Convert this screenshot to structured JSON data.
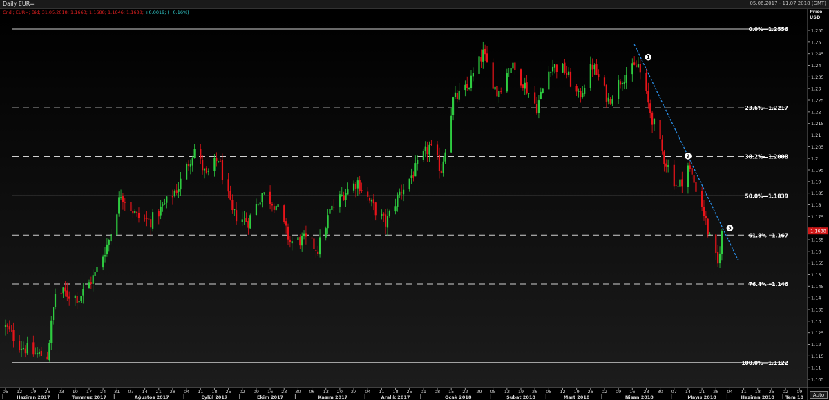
{
  "window": {
    "title": "Daily EUR=",
    "date_range": "05.06.2017 - 11.07.2018 (GMT)"
  },
  "ohlc_line": {
    "text": "Cndl; EUR=; Bid; 31.05.2018; 1.1663; 1.1688; 1.1646; 1.1688;",
    "change": "+0.0019; (+0.16%)"
  },
  "price_axis": {
    "title_line1": "Price",
    "title_line2": "USD",
    "current_price": "1.1688",
    "ticks": [
      "1.255",
      "1.25",
      "1.245",
      "1.24",
      "1.235",
      "1.23",
      "1.225",
      "1.22",
      "1.215",
      "1.21",
      "1.205",
      "1.2",
      "1.195",
      "1.19",
      "1.185",
      "1.18",
      "1.175",
      "1.17",
      "1.165",
      "1.16",
      "1.155",
      "1.15",
      "1.145",
      "1.14",
      "1.135",
      "1.13",
      "1.125",
      "1.12",
      "1.115",
      "1.11",
      "1.105"
    ]
  },
  "colors": {
    "background": "#000000",
    "up_candle": "#2ecc40",
    "down_candle": "#e8141a",
    "fib_line": "#d0d0d0",
    "trendline": "#2a8fe8",
    "price_tag": "#d01818"
  },
  "auto_button": {
    "label": "Auto"
  },
  "chart_data": {
    "type": "candlestick",
    "symbol": "EUR=",
    "ylim": [
      1.1025,
      1.2605
    ],
    "date_range": [
      "2017-06-05",
      "2018-07-11"
    ],
    "x_tick_labels": [
      "05",
      "12",
      "19",
      "26",
      "03",
      "10",
      "17",
      "24",
      "31",
      "07",
      "14",
      "21",
      "28",
      "04",
      "11",
      "18",
      "25",
      "02",
      "09",
      "16",
      "23",
      "30",
      "06",
      "13",
      "20",
      "27",
      "04",
      "11",
      "18",
      "25",
      "01",
      "08",
      "15",
      "22",
      "29",
      "05",
      "12",
      "19",
      "26",
      "05",
      "12",
      "19",
      "26",
      "02",
      "09",
      "16",
      "23",
      "30",
      "07",
      "14",
      "21",
      "28",
      "04",
      "11",
      "18",
      "25",
      "02",
      "09"
    ],
    "month_labels": [
      {
        "label": "Haziran 2017",
        "tick_index": 0
      },
      {
        "label": "Temmuz 2017",
        "tick_index": 4
      },
      {
        "label": "Ağustos 2017",
        "tick_index": 8
      },
      {
        "label": "Eylül 2017",
        "tick_index": 13
      },
      {
        "label": "Ekim 2017",
        "tick_index": 17
      },
      {
        "label": "Kasım 2017",
        "tick_index": 21
      },
      {
        "label": "Aralık 2017",
        "tick_index": 26
      },
      {
        "label": "Ocak 2018",
        "tick_index": 30
      },
      {
        "label": "Şubat 2018",
        "tick_index": 35
      },
      {
        "label": "Mart 2018",
        "tick_index": 39
      },
      {
        "label": "Nisan 2018",
        "tick_index": 43
      },
      {
        "label": "Mayıs 2018",
        "tick_index": 48
      },
      {
        "label": "Haziran 2018",
        "tick_index": 52
      },
      {
        "label": "Tem 18",
        "tick_index": 56
      }
    ],
    "fib_levels": [
      {
        "label": "0.0%—1.2556",
        "value": 1.2556,
        "style": "solid"
      },
      {
        "label": "23.6%—1.2217",
        "value": 1.2217,
        "style": "dashed"
      },
      {
        "label": "38.2%—1.2008",
        "value": 1.2008,
        "style": "dashed"
      },
      {
        "label": "50.0%—1.1839",
        "value": 1.1839,
        "style": "solid"
      },
      {
        "label": "61.8%—1.167",
        "value": 1.167,
        "style": "dashed"
      },
      {
        "label": "76.4%—1.146",
        "value": 1.146,
        "style": "dashed"
      },
      {
        "label": "100.0%—1.1122",
        "value": 1.1122,
        "style": "solid"
      }
    ],
    "trendline": {
      "start": {
        "date": "2018-04-17",
        "price": 1.249
      },
      "end": {
        "date": "2018-06-08",
        "price": 1.1565
      }
    },
    "markers": [
      {
        "label": "1",
        "date": "2018-04-24",
        "price": 1.2435
      },
      {
        "label": "2",
        "date": "2018-05-14",
        "price": 1.201
      },
      {
        "label": "3",
        "date": "2018-06-04",
        "price": 1.17
      }
    ],
    "last_close": 1.1688,
    "anchor_closes": [
      [
        "2017-06-05",
        1.1275
      ],
      [
        "2017-06-12",
        1.12
      ],
      [
        "2017-06-19",
        1.116
      ],
      [
        "2017-06-26",
        1.115
      ],
      [
        "2017-06-30",
        1.142
      ],
      [
        "2017-07-05",
        1.142
      ],
      [
        "2017-07-12",
        1.14
      ],
      [
        "2017-07-20",
        1.15
      ],
      [
        "2017-07-27",
        1.165
      ],
      [
        "2017-08-02",
        1.185
      ],
      [
        "2017-08-10",
        1.175
      ],
      [
        "2017-08-17",
        1.173
      ],
      [
        "2017-08-24",
        1.18
      ],
      [
        "2017-08-31",
        1.188
      ],
      [
        "2017-09-08",
        1.204
      ],
      [
        "2017-09-14",
        1.192
      ],
      [
        "2017-09-20",
        1.2
      ],
      [
        "2017-09-27",
        1.176
      ],
      [
        "2017-10-05",
        1.173
      ],
      [
        "2017-10-12",
        1.185
      ],
      [
        "2017-10-19",
        1.18
      ],
      [
        "2017-10-26",
        1.164
      ],
      [
        "2017-11-02",
        1.165
      ],
      [
        "2017-11-09",
        1.161
      ],
      [
        "2017-11-15",
        1.177
      ],
      [
        "2017-11-22",
        1.185
      ],
      [
        "2017-11-29",
        1.19
      ],
      [
        "2017-12-06",
        1.18
      ],
      [
        "2017-12-13",
        1.172
      ],
      [
        "2017-12-20",
        1.185
      ],
      [
        "2017-12-28",
        1.195
      ],
      [
        "2018-01-04",
        1.205
      ],
      [
        "2018-01-10",
        1.195
      ],
      [
        "2018-01-16",
        1.225
      ],
      [
        "2018-01-23",
        1.23
      ],
      [
        "2018-01-31",
        1.245
      ],
      [
        "2018-02-07",
        1.228
      ],
      [
        "2018-02-14",
        1.24
      ],
      [
        "2018-02-20",
        1.233
      ],
      [
        "2018-02-27",
        1.222
      ],
      [
        "2018-03-06",
        1.24
      ],
      [
        "2018-03-13",
        1.238
      ],
      [
        "2018-03-20",
        1.226
      ],
      [
        "2018-03-27",
        1.24
      ],
      [
        "2018-04-04",
        1.225
      ],
      [
        "2018-04-11",
        1.235
      ],
      [
        "2018-04-19",
        1.24
      ],
      [
        "2018-04-25",
        1.22
      ],
      [
        "2018-05-02",
        1.2
      ],
      [
        "2018-05-09",
        1.187
      ],
      [
        "2018-05-14",
        1.197
      ],
      [
        "2018-05-21",
        1.18
      ],
      [
        "2018-05-25",
        1.165
      ],
      [
        "2018-05-29",
        1.154
      ],
      [
        "2018-05-31",
        1.1688
      ]
    ]
  }
}
